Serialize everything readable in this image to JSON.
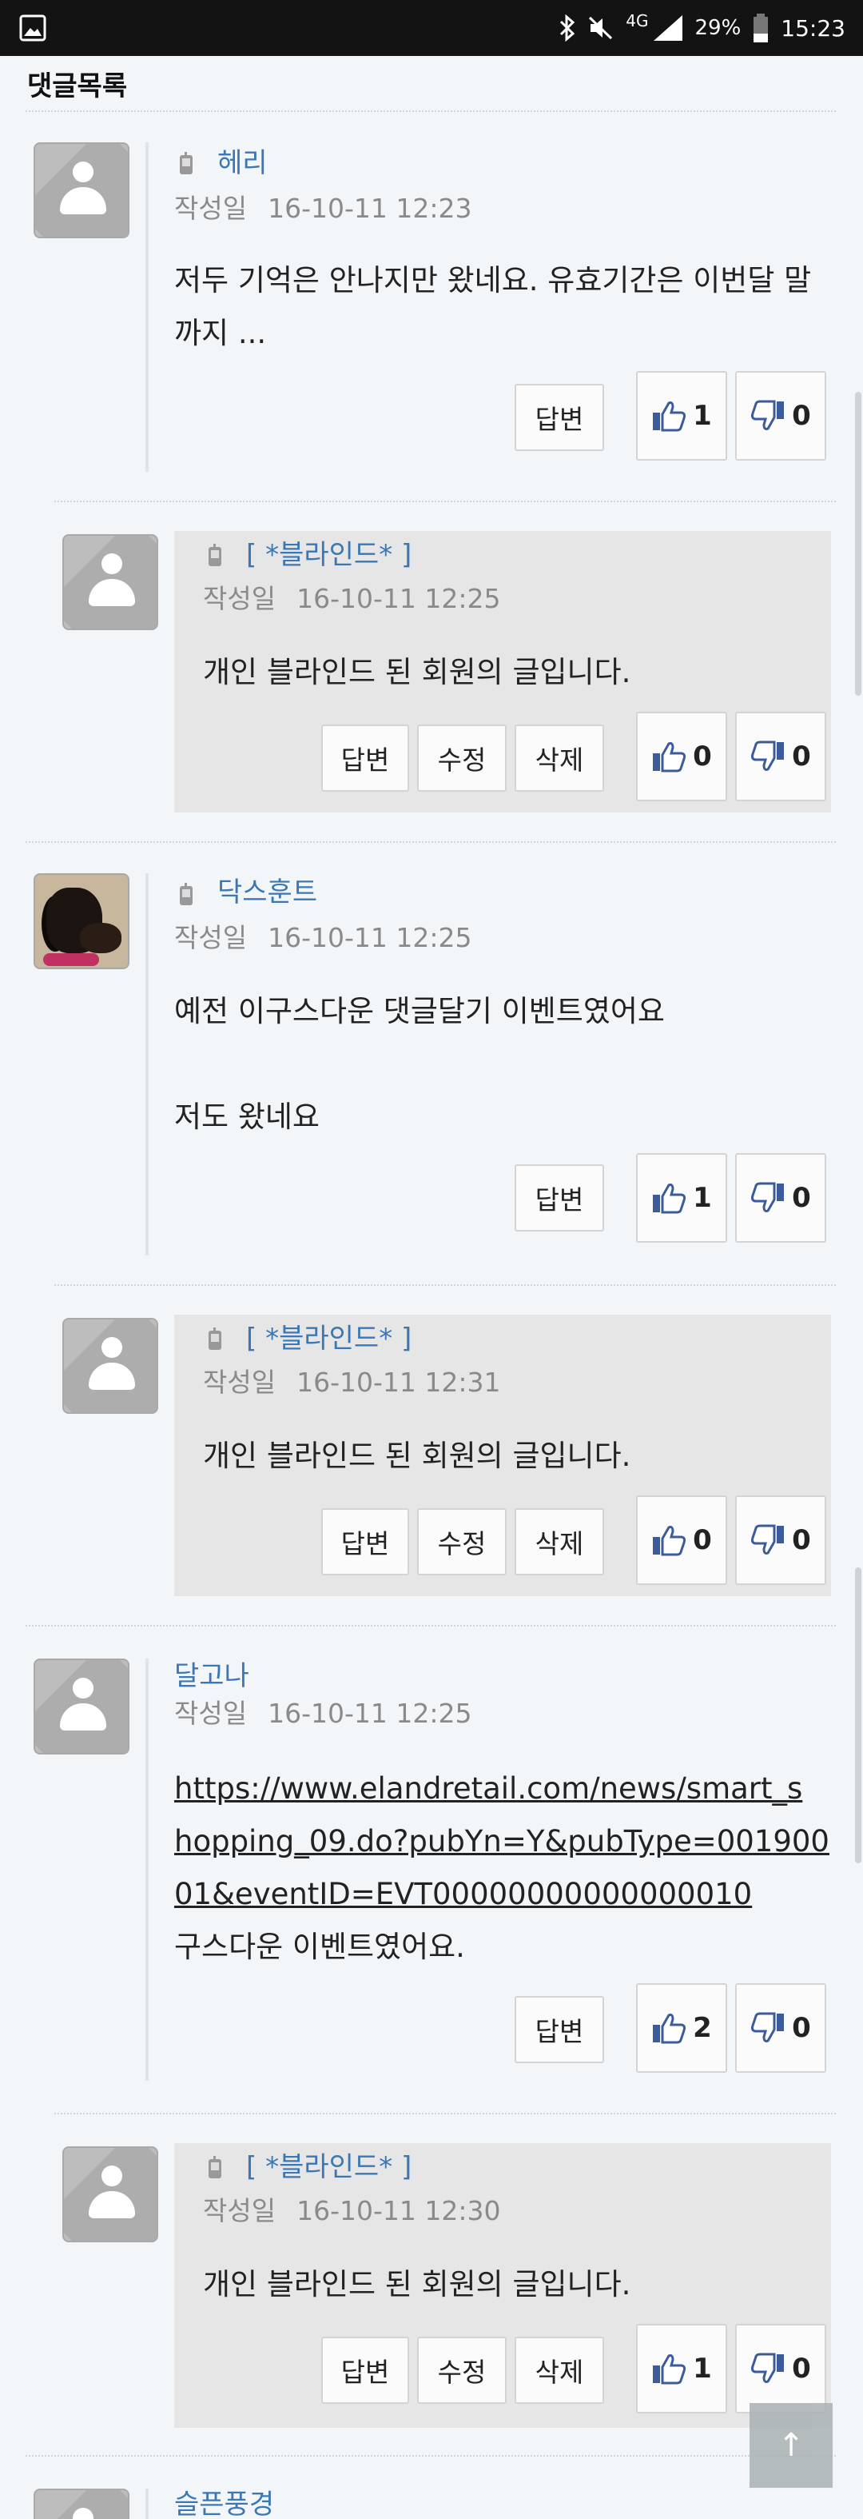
{
  "status_bar": {
    "network": "4G",
    "battery": "29%",
    "time": "15:23"
  },
  "section_title": "댓글목록",
  "comments": [
    {
      "author": "헤리",
      "date_label": "작성일",
      "date": "16-10-11 12:23",
      "text": "저두 기억은 안나지만 왔네요. 유효기간은 이번달 말까지 ...",
      "reply_label": "답변",
      "likes": "1",
      "dislikes": "0"
    },
    {
      "author": "[ *블라인드* ]",
      "date_label": "작성일",
      "date": "16-10-11 12:25",
      "text": "개인 블라인드 된 회원의 글입니다.",
      "reply_label": "답변",
      "edit_label": "수정",
      "delete_label": "삭제",
      "likes": "0",
      "dislikes": "0"
    },
    {
      "author": "닥스훈트",
      "date_label": "작성일",
      "date": "16-10-11 12:25",
      "text_line1": "예전 이구스다운 댓글달기 이벤트였어요",
      "text_line2": "저도 왔네요",
      "reply_label": "답변",
      "likes": "1",
      "dislikes": "0"
    },
    {
      "author": "[ *블라인드* ]",
      "date_label": "작성일",
      "date": "16-10-11 12:31",
      "text": "개인 블라인드 된 회원의 글입니다.",
      "reply_label": "답변",
      "edit_label": "수정",
      "delete_label": "삭제",
      "likes": "0",
      "dislikes": "0"
    },
    {
      "author": "달고나",
      "date_label": "작성일",
      "date": "16-10-11 12:25",
      "link_line1": "https://www.elandretail.com/news/smart_s",
      "link_line2": "hopping_09.do?pubYn=Y&pubType=001900",
      "link_line3": "01&eventID=EVT00000000000000010",
      "text": "구스다운 이벤트였어요.",
      "reply_label": "답변",
      "likes": "2",
      "dislikes": "0"
    },
    {
      "author": "[ *블라인드* ]",
      "date_label": "작성일",
      "date": "16-10-11 12:30",
      "text": "개인 블라인드 된 회원의 글입니다.",
      "reply_label": "답변",
      "edit_label": "수정",
      "delete_label": "삭제",
      "likes": "1",
      "dislikes": "0"
    },
    {
      "author": "슬픈풍경"
    }
  ],
  "top_button_label": "↑"
}
